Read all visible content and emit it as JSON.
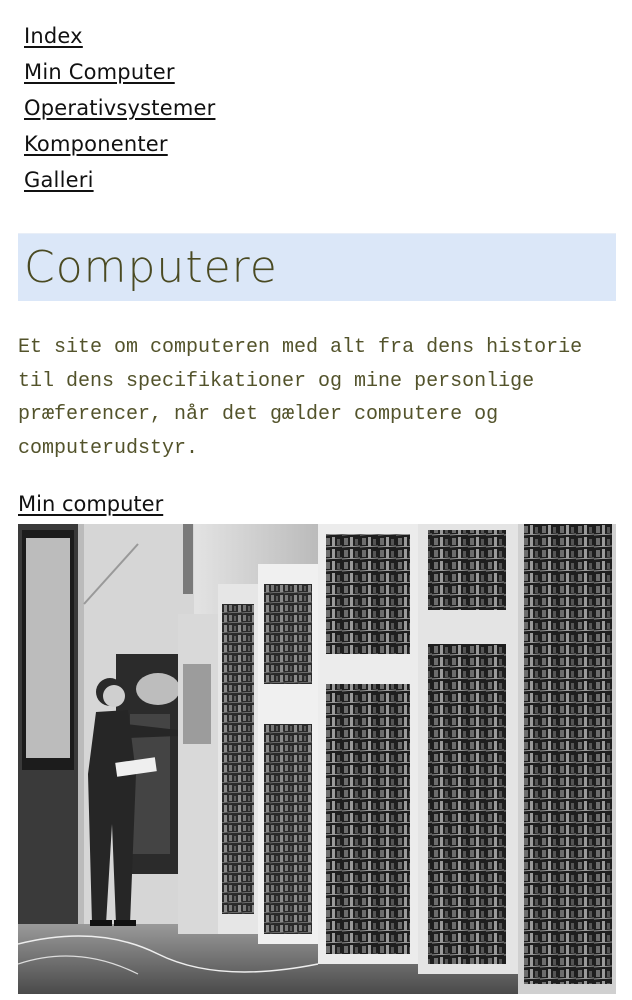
{
  "nav": {
    "items": [
      {
        "label": "Index"
      },
      {
        "label": "Min Computer"
      },
      {
        "label": "Operativsystemer"
      },
      {
        "label": "Komponenter"
      },
      {
        "label": "Galleri"
      }
    ]
  },
  "hero": {
    "title": "Computere"
  },
  "intro": {
    "text": "Et site om computeren med alt fra dens historie til dens specifikationer og mine personlige præferencer, når det gælder computere og computerudstyr."
  },
  "section": {
    "link_label": "Min computer"
  },
  "photo": {
    "subject": "black-and-white photo of a man standing beside early mainframe computer cabinets"
  }
}
